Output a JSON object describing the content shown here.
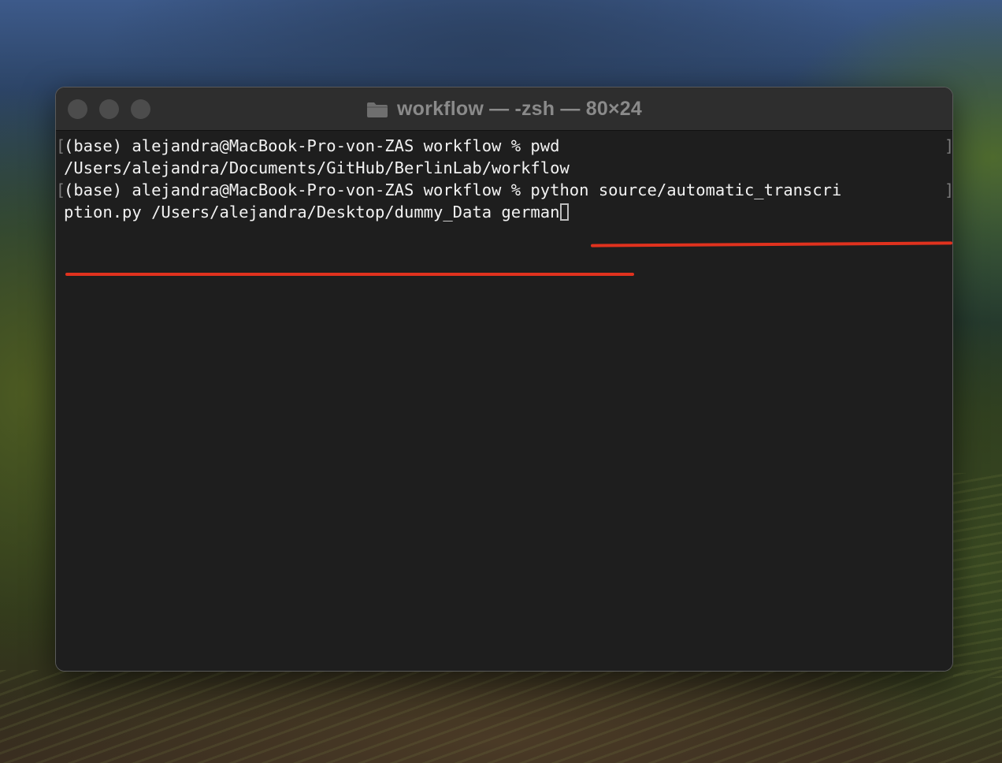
{
  "window": {
    "title": "workflow — -zsh — 80×24"
  },
  "terminal": {
    "line1": "(base) alejandra@MacBook-Pro-von-ZAS workflow % pwd",
    "line2": "/Users/alejandra/Documents/GitHub/BerlinLab/workflow",
    "line3_prompt": "(base) alejandra@MacBook-Pro-von-ZAS workflow % ",
    "line3_command": "python source/automatic_transcri",
    "line4_command": "ption.py /Users/alejandra/Desktop/dummy_Data german"
  },
  "colors": {
    "annotation_underline": "#e0321e",
    "terminal_background": "#1e1e1e",
    "terminal_text": "#f2f2f2"
  }
}
